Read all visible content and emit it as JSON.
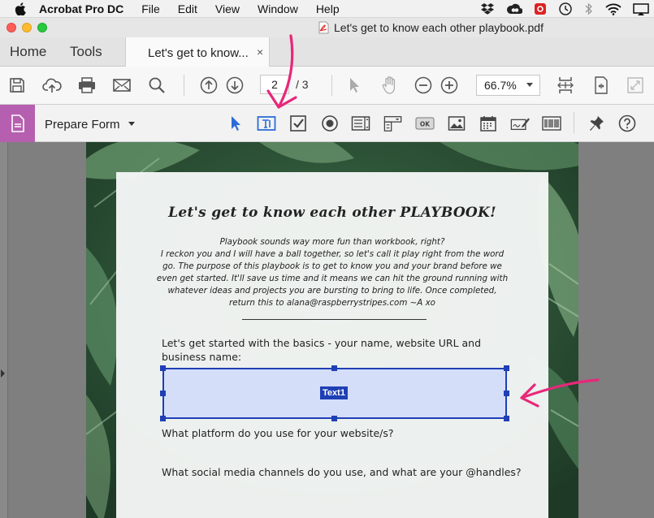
{
  "menubar": {
    "app_name": "Acrobat Pro DC",
    "items": [
      "File",
      "Edit",
      "View",
      "Window",
      "Help"
    ]
  },
  "window": {
    "title": "Let's get to know each other playbook.pdf"
  },
  "tabs": {
    "home": "Home",
    "tools": "Tools",
    "document": "Let's get to know...",
    "close": "×"
  },
  "toolbar": {
    "current_page": "2",
    "page_total": "/ 3",
    "zoom": "66.7%"
  },
  "form_bar": {
    "label": "Prepare Form"
  },
  "document": {
    "title": "Let's get to know each other PLAYBOOK!",
    "intro_lines": [
      "Playbook sounds way more fun than workbook, right?",
      "I reckon you and I will have a ball together, so let's call it play right from the word",
      "go. The purpose of this playbook is to get to know you and your brand before we",
      "even get started. It'll save us time and it means we can hit the ground running with",
      "whatever ideas and projects you are bursting to bring to life. Once completed,",
      "return this to alana@raspberrystripes.com   ~A xo"
    ],
    "question_1_line_1": "Let's get started with the basics - your name, website URL and",
    "question_1_line_2": "business name:",
    "question_2": "What platform do you use for your website/s?",
    "question_3": "What social media channels do you use, and what are your @handles?"
  },
  "form_field": {
    "name": "Text1"
  },
  "colors": {
    "accent_purple": "#b65fb0",
    "field_border": "#1f3fb5",
    "annotation_pink": "#e8277a",
    "tool_blue": "#2b6dd6"
  }
}
